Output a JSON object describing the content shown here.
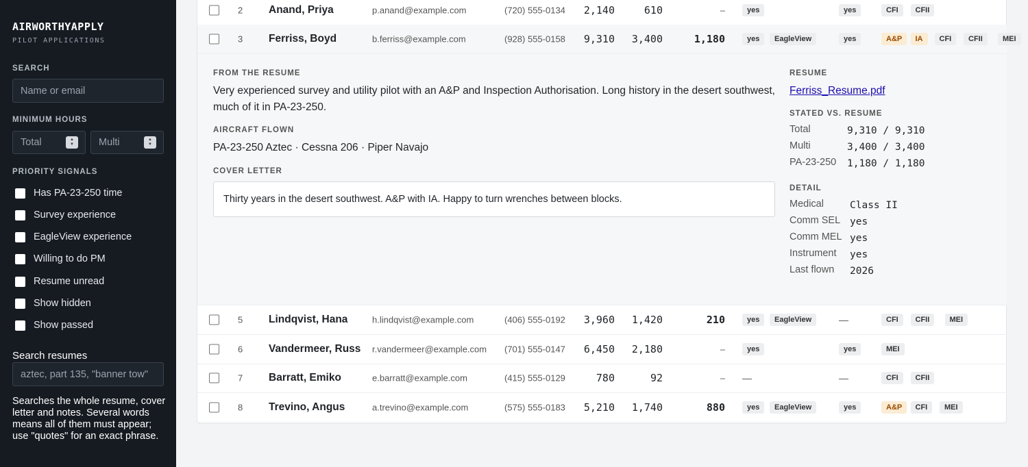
{
  "sidebar": {
    "logo": "AIRWORTHYAPPLY",
    "tagline": "PILOT APPLICATIONS",
    "search_label": "SEARCH",
    "search_placeholder": "Name or email",
    "min_hours_label": "MINIMUM HOURS",
    "total_placeholder": "Total",
    "multi_placeholder": "Multi",
    "priority_label": "PRIORITY SIGNALS",
    "signals": [
      "Has PA-23-250 time",
      "Survey experience",
      "EagleView experience",
      "Willing to do PM",
      "Resume unread",
      "Show hidden",
      "Show passed"
    ],
    "resume_search_label": "Search resumes",
    "resume_search_placeholder": "aztec, part 135, \"banner tow\"",
    "help_text": "Searches the whole resume, cover letter and notes. Several words means all of them must appear; use \"quotes\" for an exact phrase."
  },
  "rows": [
    {
      "num": "2",
      "name": "Anand, Priya",
      "email": "p.anand@example.com",
      "phone": "(720) 555-0134",
      "total": "2,140",
      "multi": "610",
      "pa": "–",
      "survey": "yes",
      "eagleview": "",
      "pm": "yes",
      "certs": [
        "CFI",
        "CFII"
      ]
    },
    {
      "num": "3",
      "name": "Ferriss, Boyd",
      "email": "b.ferriss@example.com",
      "phone": "(928) 555-0158",
      "total": "9,310",
      "multi": "3,400",
      "pa": "1,180",
      "survey": "yes",
      "eagleview": "EagleView",
      "pm": "yes",
      "certs": [
        "A&P",
        "IA",
        "CFI",
        "CFII",
        "MEI"
      ]
    },
    {
      "num": "5",
      "name": "Lindqvist, Hana",
      "email": "h.lindqvist@example.com",
      "phone": "(406) 555-0192",
      "total": "3,960",
      "multi": "1,420",
      "pa": "210",
      "survey": "yes",
      "eagleview": "EagleView",
      "pm": "—",
      "certs": [
        "CFI",
        "CFII",
        "MEI"
      ]
    },
    {
      "num": "6",
      "name": "Vandermeer, Russ",
      "email": "r.vandermeer@example.com",
      "phone": "(701) 555-0147",
      "total": "6,450",
      "multi": "2,180",
      "pa": "–",
      "survey": "yes",
      "eagleview": "",
      "pm": "yes",
      "certs": [
        "MEI"
      ]
    },
    {
      "num": "7",
      "name": "Barratt, Emiko",
      "email": "e.barratt@example.com",
      "phone": "(415) 555-0129",
      "total": "780",
      "multi": "92",
      "pa": "–",
      "survey": "—",
      "eagleview": "",
      "pm": "—",
      "certs": [
        "CFI",
        "CFII"
      ]
    },
    {
      "num": "8",
      "name": "Trevino, Angus",
      "email": "a.trevino@example.com",
      "phone": "(575) 555-0183",
      "total": "5,210",
      "multi": "1,740",
      "pa": "880",
      "survey": "yes",
      "eagleview": "EagleView",
      "pm": "yes",
      "certs": [
        "A&P",
        "CFI",
        "MEI"
      ]
    }
  ],
  "detail": {
    "from_resume_label": "FROM THE RESUME",
    "from_resume_text": "Very experienced survey and utility pilot with an A&P and Inspection Authorisation. Long history in the desert southwest, much of it in PA-23-250.",
    "aircraft_label": "AIRCRAFT FLOWN",
    "aircraft_text": "PA-23-250 Aztec · Cessna 206 · Piper Navajo",
    "cover_label": "COVER LETTER",
    "cover_text": "Thirty years in the desert southwest. A&P with IA. Happy to turn wrenches between blocks.",
    "resume_label": "RESUME",
    "resume_file": "Ferriss_Resume.pdf",
    "stated_label": "STATED VS. RESUME",
    "stated": [
      {
        "k": "Total",
        "v": "9,310 / 9,310"
      },
      {
        "k": "Multi",
        "v": "3,400 / 3,400"
      },
      {
        "k": "PA-23-250",
        "v": "1,180 / 1,180"
      }
    ],
    "detail_label": "DETAIL",
    "details": [
      {
        "k": "Medical",
        "v": "Class II"
      },
      {
        "k": "Comm SEL",
        "v": "yes"
      },
      {
        "k": "Comm MEL",
        "v": "yes"
      },
      {
        "k": "Instrument",
        "v": "yes"
      },
      {
        "k": "Last flown",
        "v": "2026"
      }
    ]
  }
}
